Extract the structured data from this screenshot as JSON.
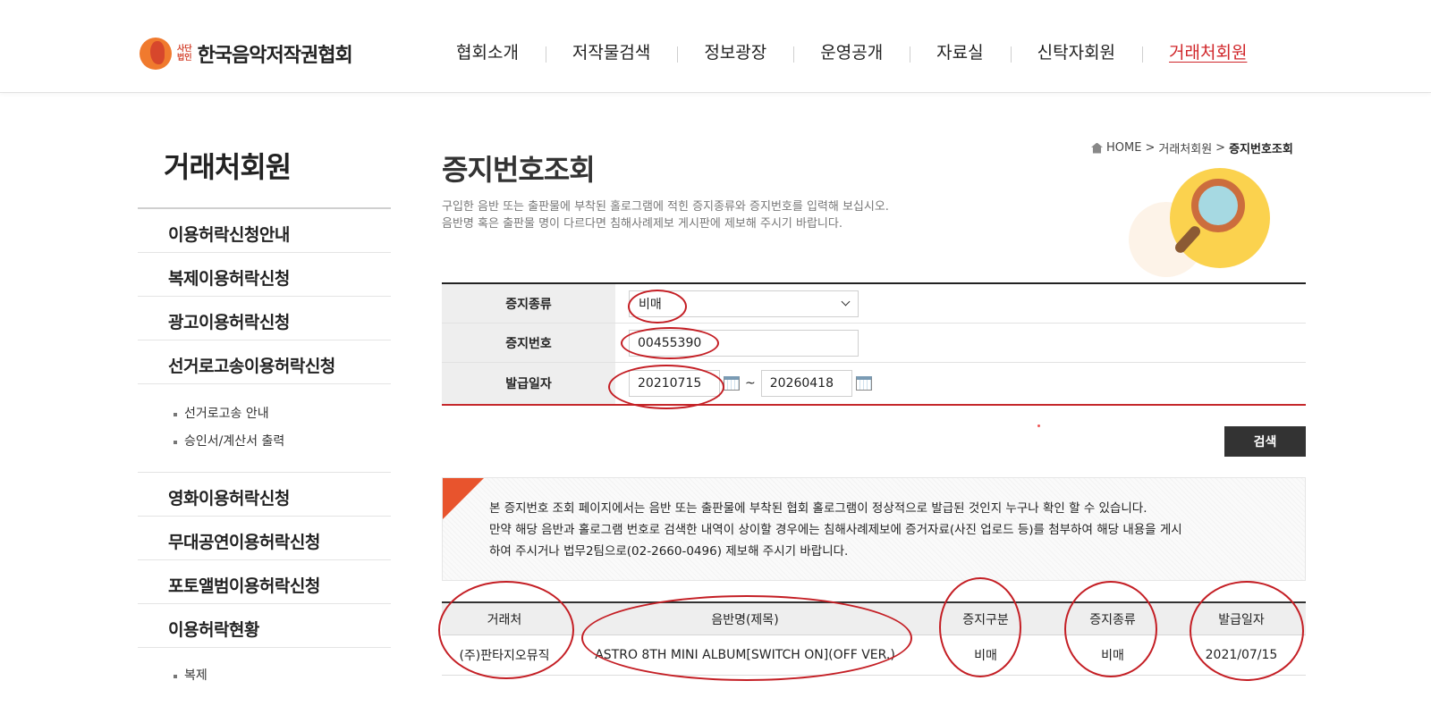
{
  "header": {
    "logo_small_1": "사단",
    "logo_small_2": "법인",
    "logo_text": "한국음악저작권협회",
    "nav": [
      "협회소개",
      "저작물검색",
      "정보광장",
      "운영공개",
      "자료실",
      "신탁자회원",
      "거래처회원"
    ]
  },
  "sidebar": {
    "title": "거래처회원",
    "items": [
      "이용허락신청안내",
      "복제이용허락신청",
      "광고이용허락신청",
      "선거로고송이용허락신청"
    ],
    "sub_items": [
      "선거로고송 안내",
      "승인서/계산서 출력"
    ],
    "items2": [
      "영화이용허락신청",
      "무대공연이용허락신청",
      "포토앨범이용허락신청",
      "이용허락현황"
    ],
    "sub_items2": [
      "복제"
    ]
  },
  "breadcrumb": {
    "home": "HOME",
    "sep": ">",
    "parent": "거래처회원",
    "current": "증지번호조회"
  },
  "page": {
    "title": "증지번호조회",
    "desc1": "구입한 음반 또는 출판물에 부착된 홀로그램에 적힌 증지종류와 증지번호를 입력해 보십시오.",
    "desc2": "음반명 혹은 출판물 명이 다르다면 침해사례제보 게시판에 제보해 주시기 바랍니다."
  },
  "form": {
    "type_label": "증지종류",
    "type_value": "비매",
    "number_label": "증지번호",
    "number_value": "00455390",
    "date_label": "발급일자",
    "date_from": "20210715",
    "date_sep": "~",
    "date_to": "20260418",
    "search_button": "검색"
  },
  "notice": {
    "line1": "본 증지번호 조회 페이지에서는 음반 또는 출판물에 부착된 협회 홀로그램이 정상적으로 발급된 것인지 누구나 확인 할 수 있습니다.",
    "line2": "만약 해당 음반과 홀로그램 번호로 검색한 내역이 상이할 경우에는 침해사례제보에 증거자료(사진 업로드 등)를 첨부하여 해당 내용을 게시",
    "line3": "하여 주시거나 법무2팀으로(02-2660-0496) 제보해 주시기 바랍니다."
  },
  "table": {
    "headers": [
      "거래처",
      "음반명(제목)",
      "증지구분",
      "증지종류",
      "발급일자"
    ],
    "rows": [
      [
        "(주)판타지오뮤직",
        "ASTRO 8TH MINI ALBUM[SWITCH ON](OFF VER.)",
        "비매",
        "비매",
        "2021/07/15"
      ]
    ]
  },
  "colors": {
    "accent": "#d0262a",
    "annotation": "#c41e24",
    "button": "#333333"
  }
}
